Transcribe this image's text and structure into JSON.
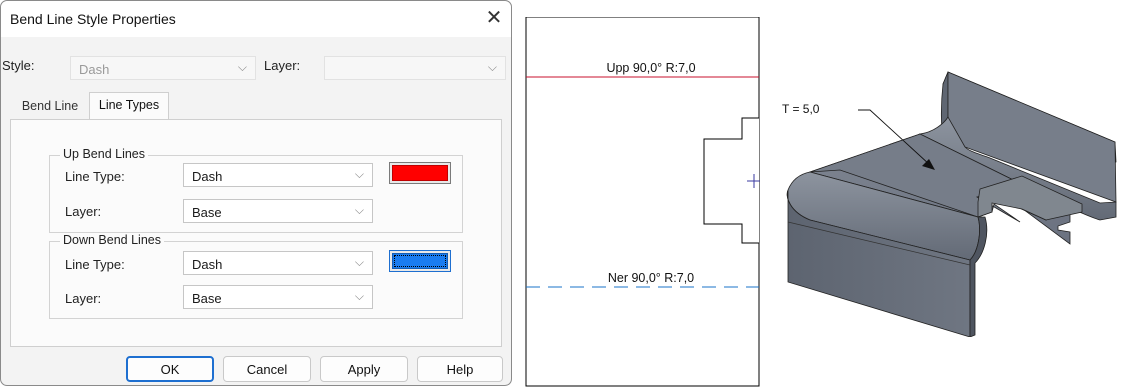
{
  "dialog": {
    "title": "Bend Line Style Properties",
    "style_label": "Style:",
    "style_value": "Dash",
    "layer_label": "Layer:",
    "layer_value": "",
    "tabs": [
      "Bend Line",
      "Line Types"
    ],
    "active_tab": "Line Types",
    "up_group": {
      "legend": "Up Bend Lines",
      "line_type_label": "Line Type:",
      "line_type_value": "Dash",
      "layer_label": "Layer:",
      "layer_value": "Base",
      "color": "#ff0000"
    },
    "down_group": {
      "legend": "Down Bend Lines",
      "line_type_label": "Line Type:",
      "line_type_value": "Dash",
      "layer_label": "Layer:",
      "layer_value": "Base",
      "color": "#1a7cf0"
    },
    "buttons": {
      "ok": "OK",
      "cancel": "Cancel",
      "apply": "Apply",
      "help": "Help"
    }
  },
  "drawing": {
    "up_label": "Upp 90,0° R:7,0",
    "down_label": "Ner 90,0° R:7,0",
    "up_line_color": "#c8102e",
    "down_line_color": "#1a73c8"
  },
  "model": {
    "thickness_label": "T = 5,0",
    "color": "#6e7480"
  }
}
